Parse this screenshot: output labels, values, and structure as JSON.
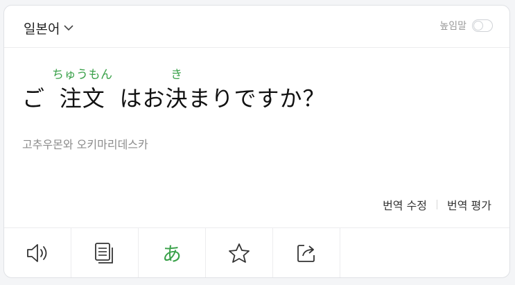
{
  "header": {
    "language": "일본어",
    "honorific_label": "높임말",
    "honorific_on": false
  },
  "sentence": {
    "segments": [
      {
        "base": "ご",
        "ruby": "",
        "space_after": true
      },
      {
        "base": "注文",
        "ruby": "ちゅうもん",
        "space_after": true
      },
      {
        "base": "はお",
        "ruby": "",
        "space_after": false
      },
      {
        "base": "決",
        "ruby": "き",
        "space_after": false
      },
      {
        "base": "まりですか？",
        "ruby": "",
        "space_after": false
      }
    ]
  },
  "pronunciation": "고추우몬와 오키마리데스카",
  "actions": {
    "edit_translation": "번역 수정",
    "rate_translation": "번역 평가"
  },
  "toolbar": {
    "kana_glyph": "あ"
  },
  "colors": {
    "accent_green": "#3aa14a",
    "text_primary": "#111111",
    "text_secondary": "#8b8b8b",
    "border": "#ececee"
  },
  "icons": [
    "chevron-down-icon",
    "speaker-icon",
    "copy-icon",
    "kana-icon",
    "star-icon",
    "share-icon"
  ]
}
